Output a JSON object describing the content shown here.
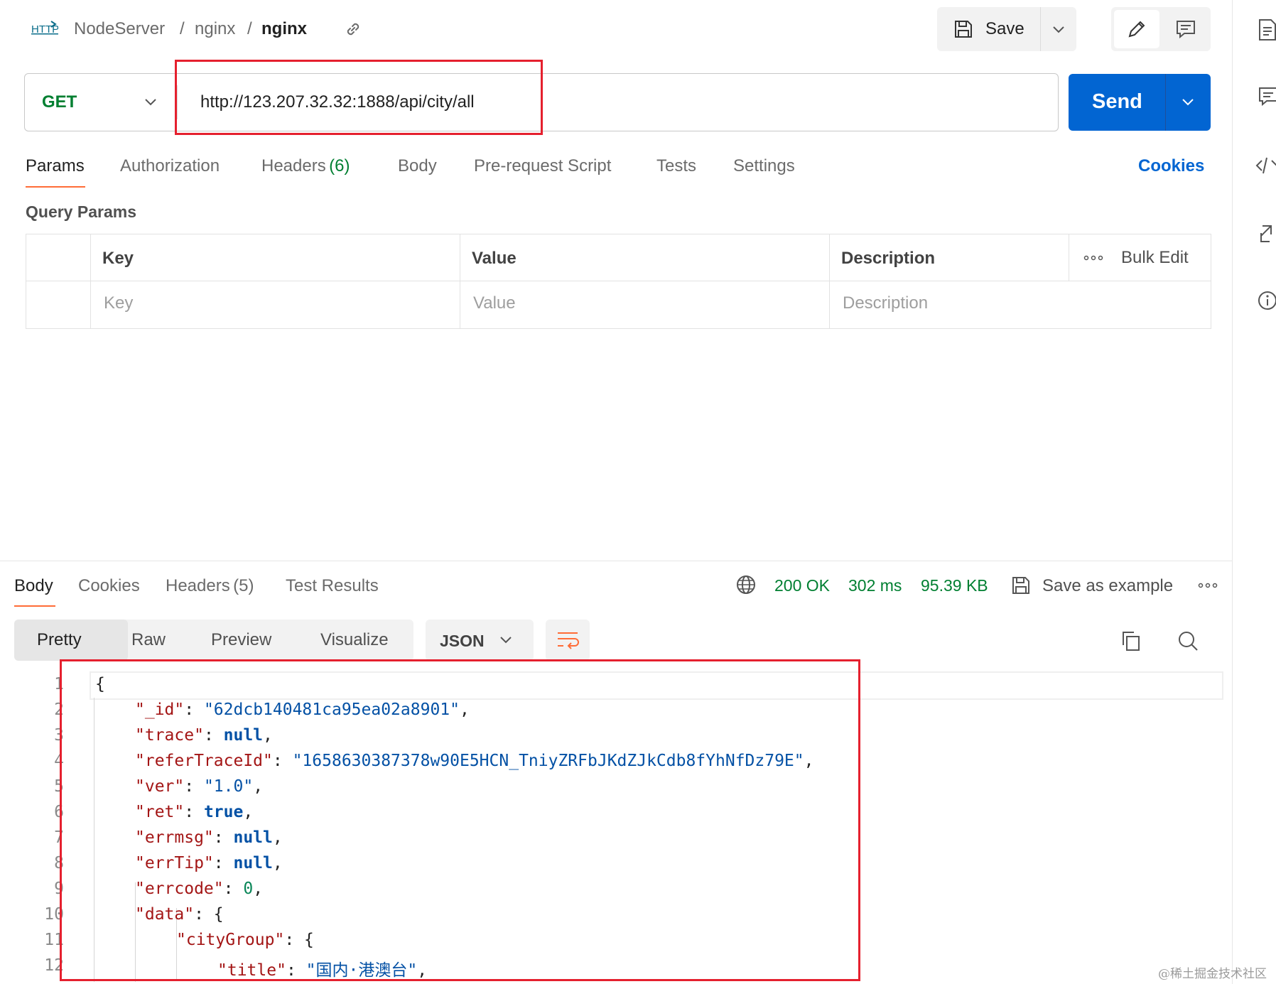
{
  "header": {
    "http_badge": "HTTP",
    "breadcrumb": [
      "NodeServer",
      "nginx",
      "nginx"
    ],
    "separator": "/",
    "save_label": "Save"
  },
  "request": {
    "method": "GET",
    "url": "http://123.207.32.32:1888/api/city/all",
    "send_label": "Send"
  },
  "request_tabs": {
    "params": "Params",
    "authorization": "Authorization",
    "headers": "Headers",
    "headers_count": "(6)",
    "body": "Body",
    "prerequest": "Pre-request Script",
    "tests": "Tests",
    "settings": "Settings",
    "cookies": "Cookies"
  },
  "query_params": {
    "title": "Query Params",
    "columns": {
      "key": "Key",
      "value": "Value",
      "description": "Description",
      "bulk_edit": "Bulk Edit"
    },
    "placeholders": {
      "key": "Key",
      "value": "Value",
      "description": "Description"
    }
  },
  "response": {
    "tabs": {
      "body": "Body",
      "cookies": "Cookies",
      "headers": "Headers",
      "headers_count": "(5)",
      "test_results": "Test Results"
    },
    "status": "200 OK",
    "time": "302 ms",
    "size": "95.39 KB",
    "save_example": "Save as example",
    "views": {
      "pretty": "Pretty",
      "raw": "Raw",
      "preview": "Preview",
      "visualize": "Visualize"
    },
    "format": "JSON",
    "line_numbers": [
      "1",
      "2",
      "3",
      "4",
      "5",
      "6",
      "7",
      "8",
      "9",
      "10",
      "11",
      "12"
    ],
    "lines": {
      "l1": "{",
      "l2_key": "\"_id\"",
      "l2_val": "\"62dcb140481ca95ea02a8901\"",
      "l3_key": "\"trace\"",
      "l3_val": "null",
      "l4_key": "\"referTraceId\"",
      "l4_val": "\"1658630387378w90E5HCN_TniyZRFbJKdZJkCdb8fYhNfDz79E\"",
      "l5_key": "\"ver\"",
      "l5_val": "\"1.0\"",
      "l6_key": "\"ret\"",
      "l6_val": "true",
      "l7_key": "\"errmsg\"",
      "l7_val": "null",
      "l8_key": "\"errTip\"",
      "l8_val": "null",
      "l9_key": "\"errcode\"",
      "l9_val": "0",
      "l10_key": "\"data\"",
      "l10_val": "{",
      "l11_key": "\"cityGroup\"",
      "l11_val": "{",
      "l12_key": "\"title\"",
      "l12_val": "\"国内·港澳台\""
    }
  },
  "watermark": "@稀土掘金技术社区",
  "colors": {
    "accent": "#0265d2",
    "method_green": "#007f31",
    "tab_underline": "#ff6c37",
    "annotation_red": "#e5202e"
  }
}
